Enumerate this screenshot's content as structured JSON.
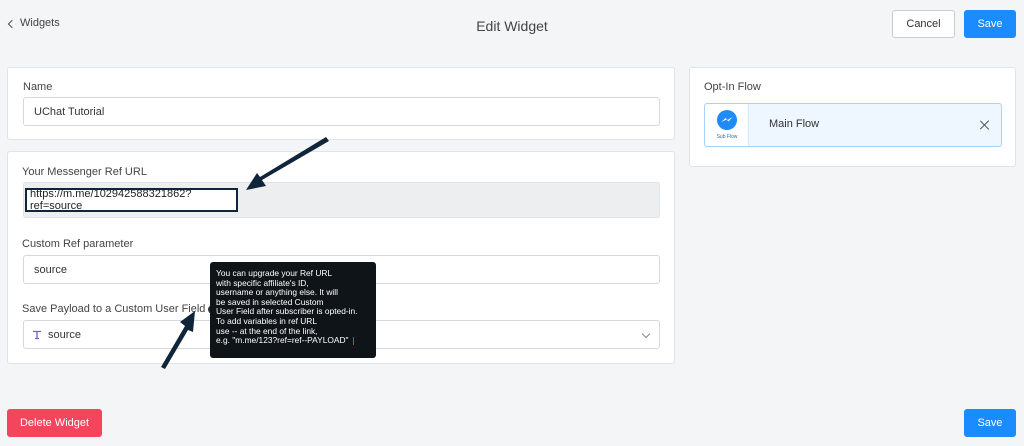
{
  "header": {
    "back_label": "Widgets",
    "title": "Edit Widget",
    "cancel_label": "Cancel",
    "save_label": "Save"
  },
  "name_card": {
    "label": "Name",
    "value": "UChat Tutorial"
  },
  "ref_card": {
    "ref_url_label": "Your Messenger Ref URL",
    "ref_url_value": "https://m.me/102942588321862?ref=source",
    "custom_ref_label": "Custom Ref parameter",
    "custom_ref_value": "source",
    "payload_label": "Save Payload to a Custom User Field",
    "payload_value": "source",
    "payload_icon": "text-field-icon"
  },
  "tooltip": {
    "lines": [
      "You can upgrade your Ref URL",
      "with specific affiliate's ID,",
      "username or anything else. It will",
      "be saved in selected Custom",
      "User Field after subscriber is opted-in.",
      "To add variables in ref URL",
      "use -- at the end of the link,",
      "e.g. \"m.me/123?ref=ref--PAYLOAD\""
    ]
  },
  "optin": {
    "label": "Opt-In Flow",
    "flow_name": "Main Flow",
    "flow_badge": "Sub Flow"
  },
  "footer": {
    "delete_label": "Delete Widget",
    "save_label": "Save"
  },
  "colors": {
    "primary": "#1a8cff",
    "danger": "#f5455c",
    "tooltip_bg": "#0f1419",
    "arrow": "#10243a"
  }
}
